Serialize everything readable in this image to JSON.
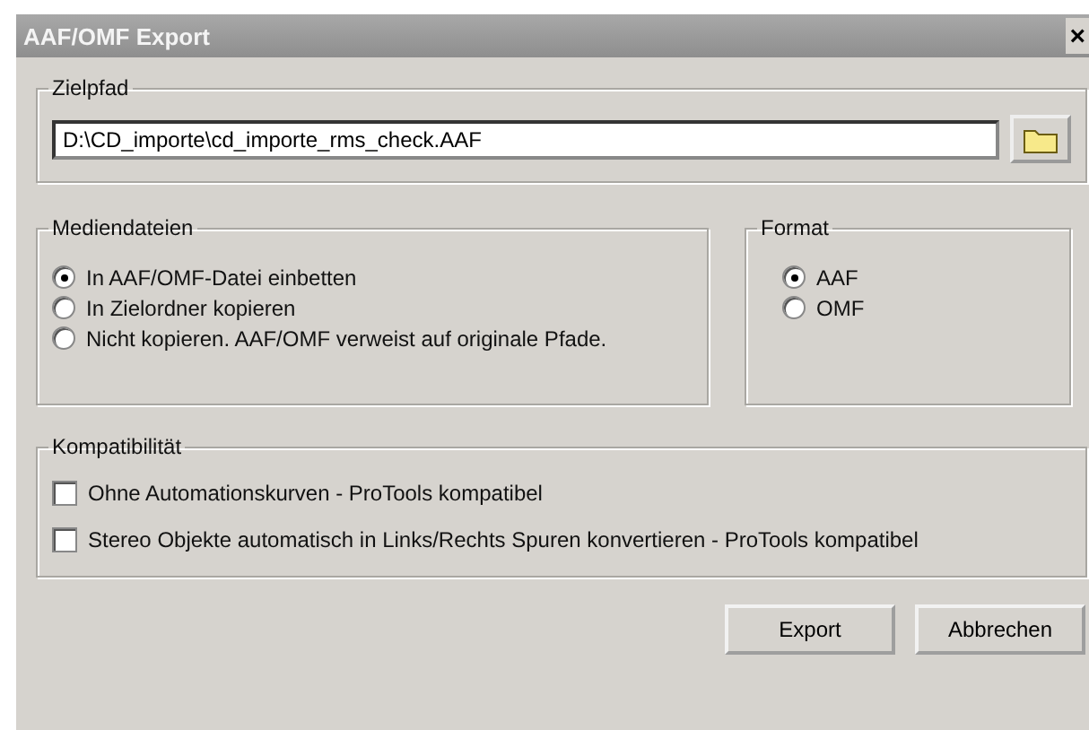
{
  "window": {
    "title": "AAF/OMF Export",
    "close": "×"
  },
  "target": {
    "legend": "Zielpfad",
    "path": "D:\\CD_importe\\cd_importe_rms_check.AAF"
  },
  "media": {
    "legend": "Mediendateien",
    "options": [
      {
        "label": "In AAF/OMF-Datei einbetten",
        "selected": true
      },
      {
        "label": "In Zielordner kopieren",
        "selected": false
      },
      {
        "label": "Nicht kopieren. AAF/OMF verweist auf originale Pfade.",
        "selected": false
      }
    ]
  },
  "format": {
    "legend": "Format",
    "options": [
      {
        "label": "AAF",
        "selected": true
      },
      {
        "label": "OMF",
        "selected": false
      }
    ]
  },
  "compat": {
    "legend": "Kompatibilität",
    "options": [
      {
        "label": "Ohne Automationskurven - ProTools kompatibel",
        "checked": false
      },
      {
        "label": "Stereo Objekte automatisch in Links/Rechts Spuren konvertieren - ProTools kompatibel",
        "checked": false
      }
    ]
  },
  "buttons": [
    "Export",
    "Abbrechen"
  ]
}
